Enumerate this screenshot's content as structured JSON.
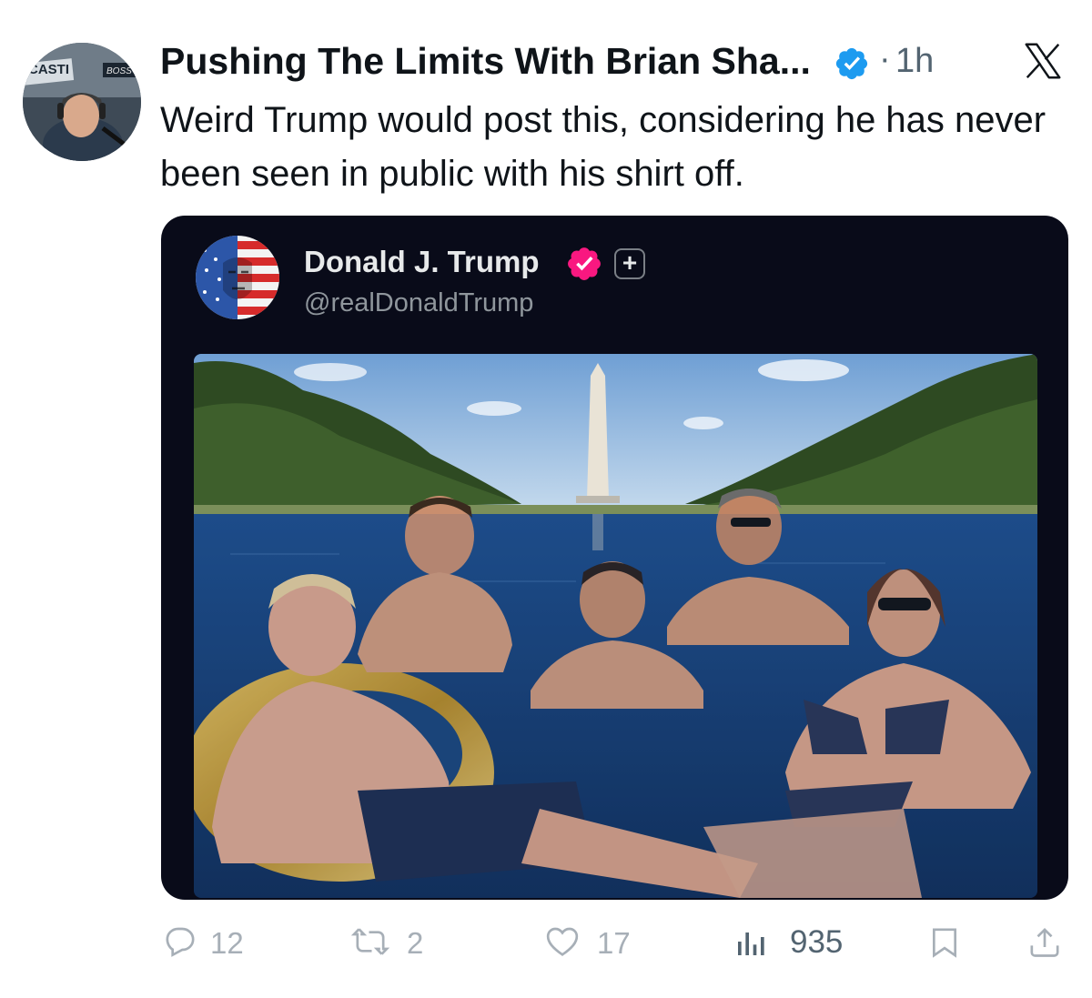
{
  "post": {
    "author_name": "Pushing The Limits With Brian Sha...",
    "separator": "·",
    "time": "1h",
    "text": "Weird Trump would post this, considering he has never been seen in public with his shirt off.",
    "avatar_text_left": "CASTI",
    "avatar_text_right": "BOSS",
    "icons": {
      "verified": "verified-badge-icon",
      "platform": "x-logo-icon"
    }
  },
  "quoted_post": {
    "name": "Donald J. Trump",
    "handle": "@realDonaldTrump",
    "plus_label": "+",
    "icons": {
      "verified": "verified-badge-icon",
      "plus": "plus-icon"
    }
  },
  "actions": {
    "replies": "12",
    "reposts": "2",
    "likes": "17",
    "views": "935",
    "icons": [
      "reply-icon",
      "repost-icon",
      "like-icon",
      "views-icon",
      "bookmark-icon",
      "share-icon"
    ]
  },
  "colors": {
    "verified_blue": "#1d9bf0",
    "verified_pink": "#f91880",
    "quote_background": "#090b19",
    "muted_text": "#536471",
    "action_icon": "#a7afb7"
  }
}
